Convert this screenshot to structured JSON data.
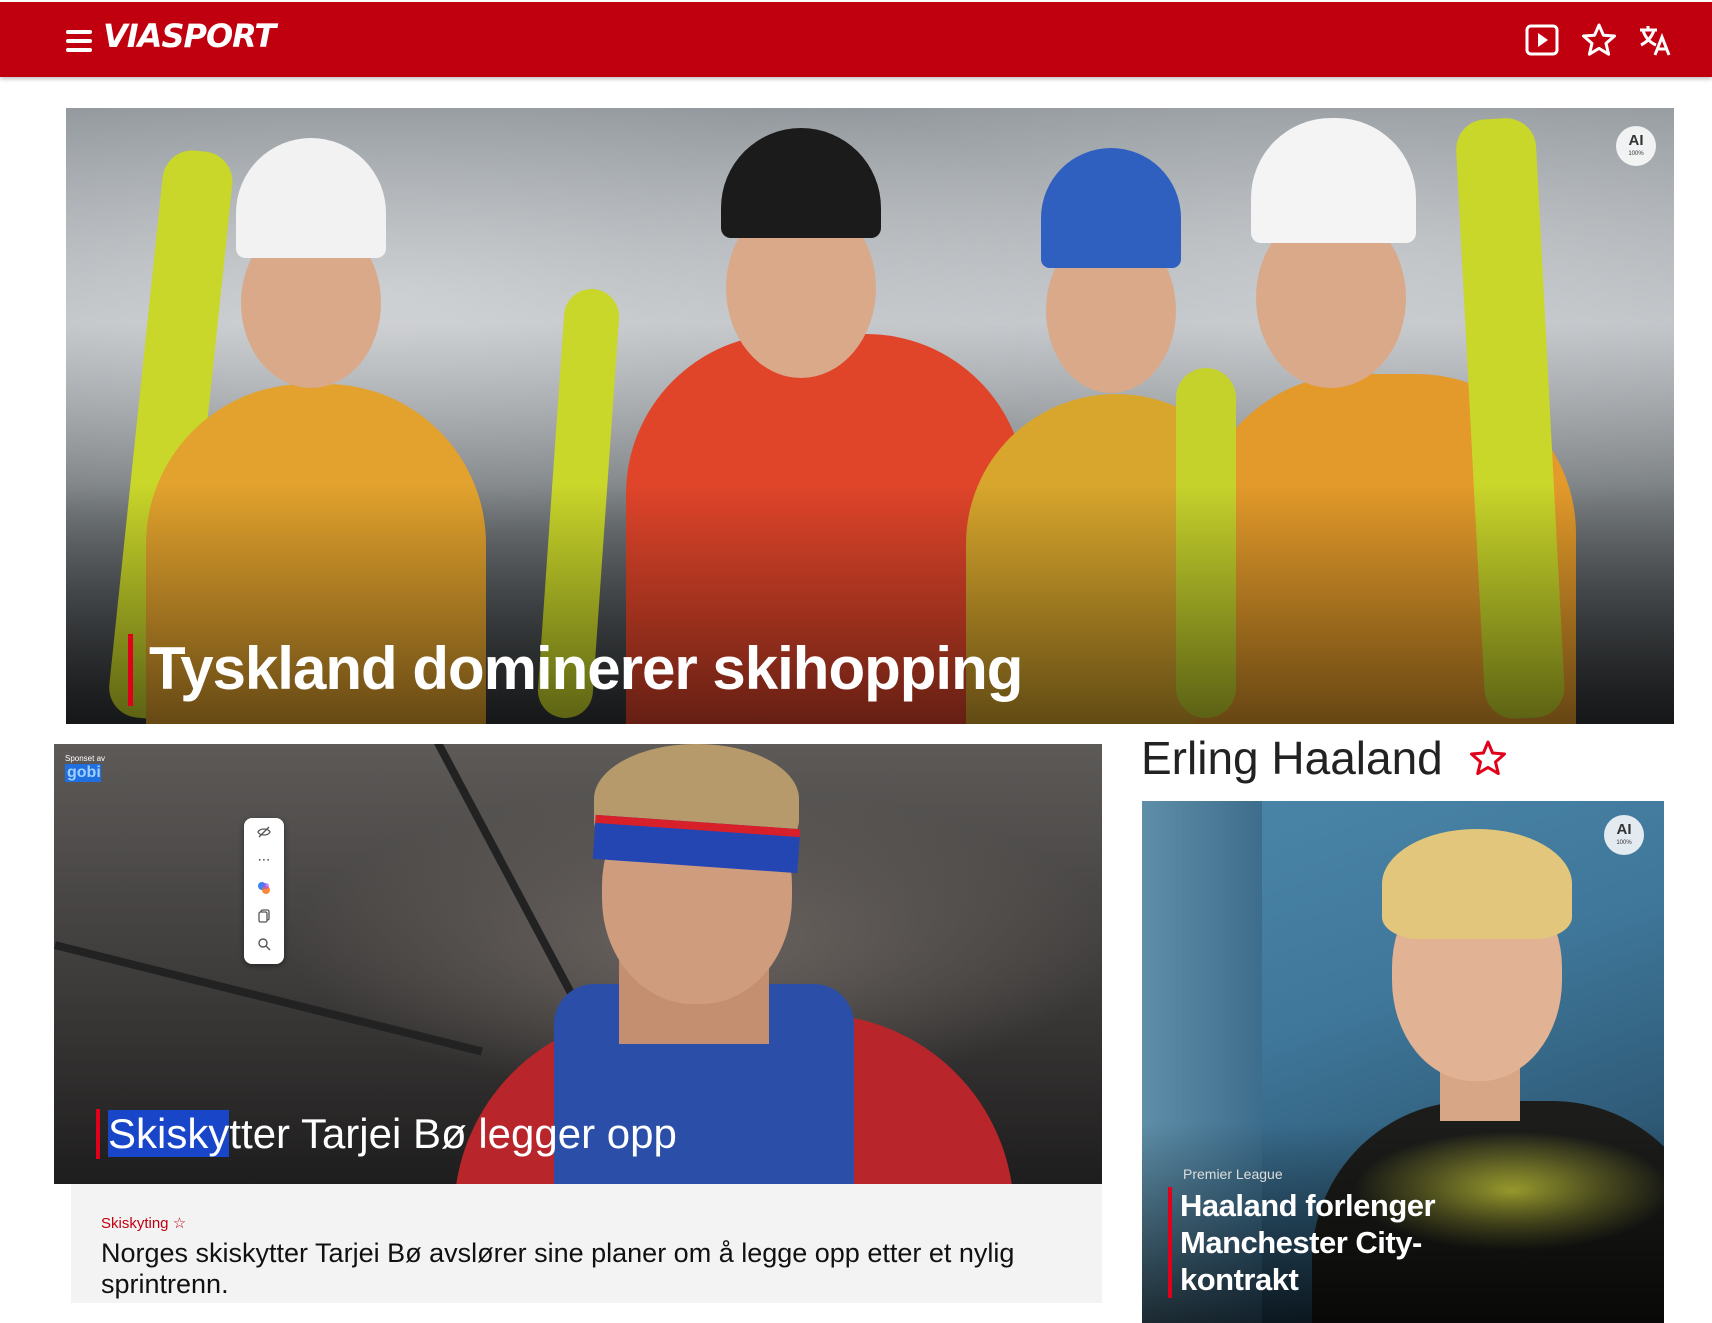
{
  "header": {
    "logo": "VIASPORT",
    "brand_color": "#c0000f",
    "icons": [
      "menu-icon",
      "play-icon",
      "star-icon",
      "translate-icon"
    ]
  },
  "hero": {
    "title": "Tyskland dominerer skihopping",
    "ai_badge": "AI",
    "ai_badge_sub": "100%"
  },
  "feature": {
    "sponsor_label": "Sponset av",
    "sponsor_brand": "gobi",
    "title_selected": "Skisky",
    "title_rest": "tter Tarjei Bø legger opp",
    "kicker": "Skiskyting",
    "caption": "Norges skiskytter Tarjei Bø avslører sine planer om å legge opp etter et nylig sprintrenn.",
    "toolbar_icons": [
      "hide-icon",
      "more-icon",
      "copilot-icon",
      "copy-icon",
      "search-icon"
    ]
  },
  "side": {
    "section_title": "Erling Haaland",
    "kicker": "Premier League",
    "title": "Haaland forlenger Manchester City-kontrakt",
    "ai_badge": "AI",
    "ai_badge_sub": "100%"
  },
  "accent_color": "#e0001a"
}
